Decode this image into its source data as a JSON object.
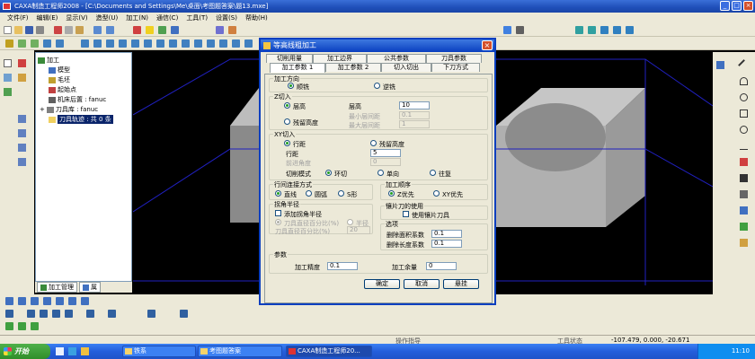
{
  "window": {
    "title": "CAXA制造工程师2008 - [C:\\Documents and Settings\\Me\\桌面\\考图题答案\\题13.mxe]"
  },
  "menu": [
    "文件(F)",
    "编辑(E)",
    "显示(V)",
    "造型(U)",
    "加工(N)",
    "通信(C)",
    "工具(T)",
    "设置(S)",
    "帮助(H)"
  ],
  "tree": {
    "items": [
      {
        "label": "加工"
      },
      {
        "label": "模型"
      },
      {
        "label": "毛坯"
      },
      {
        "label": "起始点"
      },
      {
        "label": "机床后置 : fanuc"
      },
      {
        "label": "刀具库 : fanuc"
      },
      {
        "label": "刀具轨迹 : 共 0 条"
      }
    ],
    "tabs": [
      "加工管理",
      "属"
    ]
  },
  "dialog": {
    "title": "等高线粗加工",
    "tabs_row1": [
      "切削用量",
      "加工边界",
      "公共参数",
      "刀具参数"
    ],
    "tabs_row2": [
      "加工参数 1",
      "加工参数 2",
      "切入切出",
      "下刀方式"
    ],
    "machining_direction": {
      "label": "加工方向",
      "options": [
        "顺铣",
        "逆铣"
      ],
      "selected": "顺铣"
    },
    "z_cut": {
      "label": "Z切入",
      "options": [
        "层高",
        "残留高度"
      ],
      "selected": "层高",
      "layer_height_label": "层高",
      "layer_height_value": "10",
      "min_layer_label": "最小层间距",
      "min_layer_value": "0.1",
      "max_layer_label": "最大层间距",
      "max_layer_value": "1"
    },
    "xy_cut": {
      "label": "XY切入",
      "options": [
        "行距",
        "残留高度"
      ],
      "selected": "行距",
      "step_label": "行距",
      "step_value": "5",
      "angle_label": "前进角度",
      "angle_value": "0",
      "mode_label": "切削模式",
      "modes": [
        "环切",
        "单向",
        "往复"
      ],
      "mode_selected": "环切"
    },
    "row_connect": {
      "label": "行间连接方式",
      "options": [
        "直线",
        "圆弧",
        "S形"
      ],
      "selected": "直线"
    },
    "order": {
      "label": "加工顺序",
      "options": [
        "Z优先",
        "XY优先"
      ],
      "selected": "Z优先"
    },
    "corner": {
      "label": "拐角半径",
      "add_label": "添加拐角半径",
      "options": [
        "刀具直径百分比(%)",
        "半径"
      ],
      "pct_label": "刀具直径百分比(%)",
      "pct_value": "20"
    },
    "insert_tool": {
      "label": "镶片刀的使用",
      "use_label": "使用镶片刀具"
    },
    "options_group": {
      "label": "选项",
      "min_area_label": "删除面积系数",
      "min_area_value": "0.1",
      "min_len_label": "删除长度系数",
      "min_len_value": "0.1"
    },
    "params": {
      "label": "参数",
      "accuracy_label": "加工精度",
      "accuracy_value": "0.1",
      "allowance_label": "加工余量",
      "allowance_value": "0"
    },
    "buttons": {
      "ok": "确定",
      "cancel": "取消",
      "hang": "悬挂"
    }
  },
  "status": {
    "hint": "操作指导",
    "tool_state": "工具状态",
    "coords": "-107.479, 0.000, -20.671"
  },
  "taskbar": {
    "start": "开始",
    "tasks": [
      "铁系",
      "考图题答案",
      "CAXA制造工程师20..."
    ],
    "clock": "11:10"
  }
}
